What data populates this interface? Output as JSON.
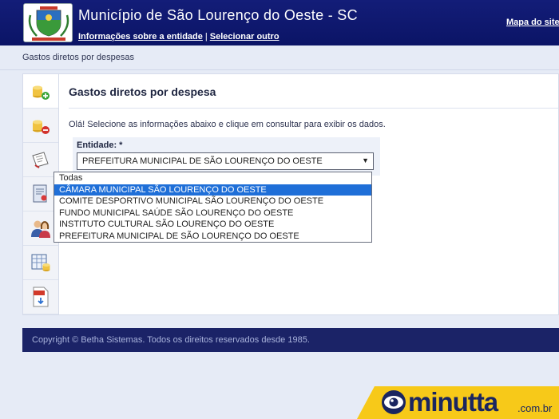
{
  "header": {
    "title": "Município de São Lourenço do Oeste - SC",
    "link_info": "Informações sobre a entidade",
    "separator": "|",
    "link_select": "Selecionar outro",
    "sitemap": "Mapa do site"
  },
  "breadcrumb": "Gastos diretos por despesas",
  "sidebar": {
    "items": [
      {
        "icon": "coins-add-icon"
      },
      {
        "icon": "coins-remove-icon"
      },
      {
        "icon": "document-pen-icon"
      },
      {
        "icon": "certificate-icon"
      },
      {
        "icon": "people-icon"
      },
      {
        "icon": "spreadsheet-coins-icon"
      },
      {
        "icon": "pdf-download-icon"
      }
    ]
  },
  "main": {
    "title": "Gastos diretos por despesa",
    "intro": "Olá! Selecione as informações abaixo e clique em consultar para exibir os dados.",
    "entity_label": "Entidade: *",
    "entity_selected": "PREFEITURA MUNICIPAL DE SÃO LOURENÇO DO OESTE",
    "arrow": "▼",
    "options": [
      "Todas",
      "CÂMARA MUNICIPAL SÃO LOURENÇO DO OESTE",
      "COMITE DESPORTIVO MUNICIPAL SÃO LOURENÇO DO OESTE",
      "FUNDO MUNICIPAL SAÚDE SÃO LOURENÇO DO OESTE",
      "INSTITUTO CULTURAL SÃO LOURENÇO DO OESTE",
      "PREFEITURA MUNICIPAL DE SÃO LOURENÇO DO OESTE"
    ],
    "highlighted_option": "CÂMARA MUNICIPAL SÃO LOURENÇO DO OESTE"
  },
  "footer": {
    "copyright": "Copyright © Betha Sistemas. Todos os direitos reservados desde 1985."
  },
  "watermark": {
    "name": "minutta",
    "tld": ".com.br"
  },
  "colors": {
    "header": "#131d78",
    "footer": "#1b2367",
    "highlight": "#1f6fd8",
    "watermark": "#f7c919"
  }
}
